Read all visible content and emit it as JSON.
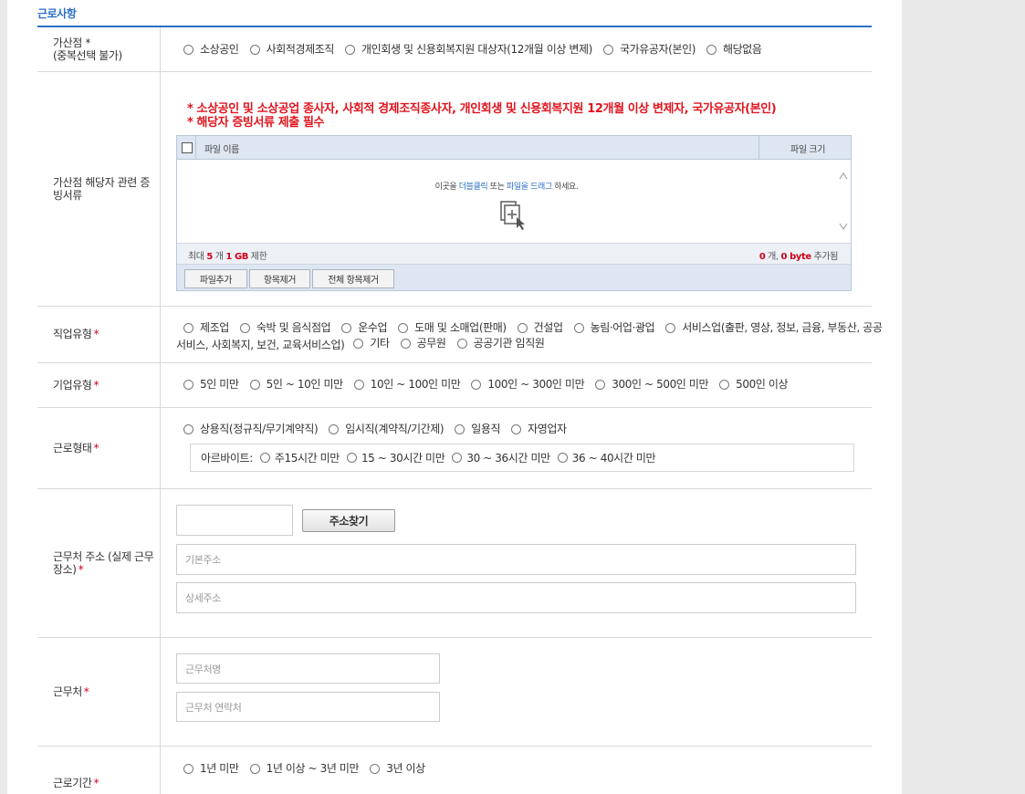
{
  "section": {
    "title": "근로사항"
  },
  "bonus": {
    "label": "가산점",
    "label_note": "(중복선택 불가)",
    "options": [
      "소상공인",
      "사회적경제조직",
      "개인회생 및 신용회복지원 대상자(12개월 이상 변제)",
      "국가유공자(본인)",
      "해당없음"
    ]
  },
  "proof": {
    "label": "가산점 해당자 관련 증빙서류",
    "notice1": "* 소상공인 및 소상공업 종사자, 사회적 경제조직종사자, 개인회생 및 신용회복지원 12개월 이상 변제자, 국가유공자(본인)",
    "notice2": "* 해당자 증빙서류 제출 필수",
    "col_name": "파일 이름",
    "col_size": "파일 크기",
    "drop_pre": "이곳을 ",
    "drop_dbl": "더블클릭",
    "drop_mid": " 또는 ",
    "drop_drag": "파일을 드래그",
    "drop_post": " 하세요.",
    "limit_pre": "최대 ",
    "limit_count": "5",
    "limit_mid": " 개 ",
    "limit_size": "1 GB",
    "limit_post": " 제한",
    "added_count": "0",
    "added_mid": " 개, ",
    "added_size": "0 byte",
    "added_post": " 추가됨",
    "btn_add": "파일추가",
    "btn_remove": "항목제거",
    "btn_remove_all": "전체 항목제거"
  },
  "job_type": {
    "label": "직업유형",
    "options_line1": [
      "제조업",
      "숙박 및 음식점업",
      "운수업",
      "도매 및 소매업(판매)",
      "건설업",
      "농림·어업·광업",
      "서비스업(출판, 영상, 정보, 금융, 부동산, 공공"
    ],
    "options_line2_cont": "서비스, 사회복지, 보건, 교육서비스업)",
    "options_line2": [
      "기타",
      "공무원",
      "공공기관 임직원"
    ]
  },
  "company_type": {
    "label": "기업유형",
    "options": [
      "5인 미만",
      "5인 ~ 10인 미만",
      "10인 ~ 100인 미만",
      "100인 ~ 300인 미만",
      "300인 ~ 500인 미만",
      "500인 이상"
    ]
  },
  "work_form": {
    "label": "근로형태",
    "options": [
      "상용직(정규직/무기계약직)",
      "임시직(계약직/기간제)",
      "일용직",
      "자영업자"
    ],
    "parttime_label": "아르바이트:",
    "parttime_options": [
      "주15시간 미만",
      "15 ~ 30시간 미만",
      "30 ~ 36시간 미만",
      "36 ~ 40시간 미만"
    ]
  },
  "address": {
    "label": "근무처 주소 (실제 근무장소)",
    "search_button": "주소찾기",
    "base_placeholder": "기본주소",
    "detail_placeholder": "상세주소"
  },
  "workplace": {
    "label": "근무처",
    "name_placeholder": "근무처명",
    "contact_placeholder": "근무처 연락처"
  },
  "period": {
    "label": "근로기간",
    "options": [
      "1년 미만",
      "1년 이상 ~ 3년 미만",
      "3년 이상"
    ]
  },
  "required_mark": "*"
}
